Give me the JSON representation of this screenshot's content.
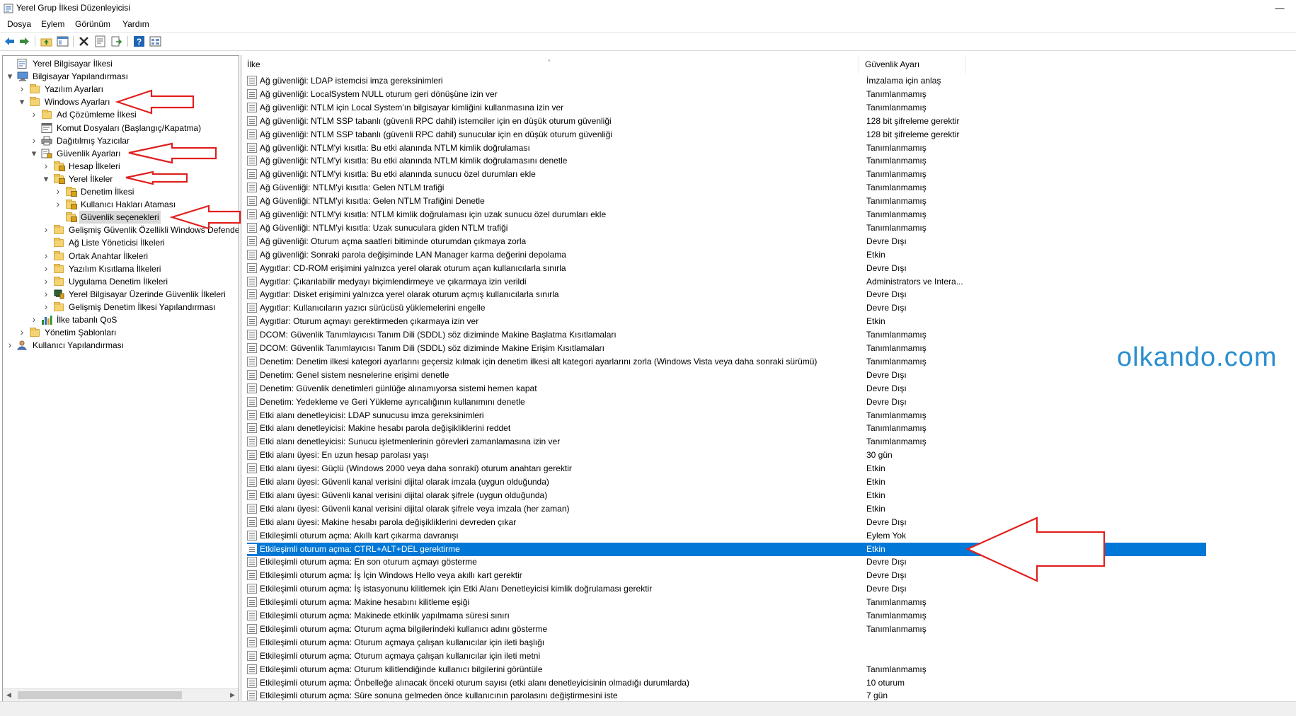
{
  "window": {
    "title": "Yerel Grup İlkesi Düzenleyicisi",
    "minimize": "—"
  },
  "menu": [
    "Dosya",
    "Eylem",
    "Görünüm",
    "Yardım"
  ],
  "toolbar": {
    "buttons": [
      "back-arrow-icon",
      "forward-arrow-icon",
      "up-folder-icon",
      "show-hide-tree-icon",
      "delete-icon",
      "properties-icon",
      "export-list-icon",
      "help-icon",
      "view-icon"
    ],
    "colors": {
      "back": "#1e78c8",
      "forward": "#3c8c3c",
      "delete": "#303030",
      "help": "#1e64b4"
    }
  },
  "tree": [
    {
      "level": 0,
      "label": "Yerel Bilgisayar İlkesi",
      "expander": "",
      "icon": "computer-policy-icon"
    },
    {
      "level": 0,
      "label": "Bilgisayar Yapılandırması",
      "expander": "open",
      "icon": "computer-icon"
    },
    {
      "level": 1,
      "label": "Yazılım Ayarları",
      "expander": "closed",
      "icon": "folder-icon"
    },
    {
      "level": 1,
      "label": "Windows Ayarları",
      "expander": "open",
      "icon": "folder-icon"
    },
    {
      "level": 2,
      "label": "Ad Çözümleme İlkesi",
      "expander": "closed",
      "icon": "folder-icon"
    },
    {
      "level": 2,
      "label": "Komut Dosyaları (Başlangıç/Kapatma)",
      "expander": "",
      "icon": "script-icon"
    },
    {
      "level": 2,
      "label": "Dağıtılmış Yazıcılar",
      "expander": "closed",
      "icon": "printer-icon"
    },
    {
      "level": 2,
      "label": "Güvenlik Ayarları",
      "expander": "open",
      "icon": "security-settings-icon"
    },
    {
      "level": 3,
      "label": "Hesap İlkeleri",
      "expander": "closed",
      "icon": "secure-folder-icon"
    },
    {
      "level": 3,
      "label": "Yerel İlkeler",
      "expander": "open",
      "icon": "secure-folder-icon"
    },
    {
      "level": 4,
      "label": "Denetim İlkesi",
      "expander": "closed",
      "icon": "secure-folder-icon"
    },
    {
      "level": 4,
      "label": "Kullanıcı Hakları Ataması",
      "expander": "closed",
      "icon": "secure-folder-icon"
    },
    {
      "level": 4,
      "label": "Güvenlik seçenekleri",
      "expander": "",
      "icon": "secure-folder-icon",
      "selected": true
    },
    {
      "level": 3,
      "label": "Gelişmiş Güvenlik Özellikli Windows Defender",
      "expander": "closed",
      "icon": "folder-icon"
    },
    {
      "level": 3,
      "label": "Ağ Liste Yöneticisi İlkeleri",
      "expander": "",
      "icon": "folder-icon"
    },
    {
      "level": 3,
      "label": "Ortak Anahtar İlkeleri",
      "expander": "closed",
      "icon": "folder-icon"
    },
    {
      "level": 3,
      "label": "Yazılım Kısıtlama İlkeleri",
      "expander": "closed",
      "icon": "folder-icon"
    },
    {
      "level": 3,
      "label": "Uygulama Denetim İlkeleri",
      "expander": "closed",
      "icon": "folder-icon"
    },
    {
      "level": 3,
      "label": "Yerel Bilgisayar Üzerinde Güvenlik İlkeleri",
      "expander": "closed",
      "icon": "ip-security-icon"
    },
    {
      "level": 3,
      "label": "Gelişmiş Denetim İlkesi Yapılandırması",
      "expander": "closed",
      "icon": "folder-icon"
    },
    {
      "level": 2,
      "label": "İlke tabanlı QoS",
      "expander": "closed",
      "icon": "qos-chart-icon"
    },
    {
      "level": 1,
      "label": "Yönetim Şablonları",
      "expander": "closed",
      "icon": "folder-icon"
    },
    {
      "level": 0,
      "label": "Kullanıcı Yapılandırması",
      "expander": "closed",
      "icon": "user-icon"
    }
  ],
  "list": {
    "columns": [
      "İlke",
      "Güvenlik Ayarı"
    ],
    "selected_index": 35,
    "rows": [
      [
        "Ağ güvenliği: LDAP istemcisi imza gereksinimleri",
        "İmzalama için anlaş"
      ],
      [
        "Ağ güvenliği: LocalSystem NULL oturum geri dönüşüne izin ver",
        "Tanımlanmamış"
      ],
      [
        "Ağ güvenliği: NTLM için Local System'ın bilgisayar kimliğini kullanmasına izin ver",
        "Tanımlanmamış"
      ],
      [
        "Ağ güvenliği: NTLM SSP tabanlı (güvenli RPC dahil) istemciler için en düşük oturum güvenliği",
        "128 bit şifreleme gerektir"
      ],
      [
        "Ağ güvenliği: NTLM SSP tabanlı (güvenli RPC dahil) sunucular için en düşük oturum güvenliği",
        "128 bit şifreleme gerektir"
      ],
      [
        "Ağ güvenliği: NTLM'yi kısıtla: Bu etki alanında NTLM kimlik doğrulaması",
        "Tanımlanmamış"
      ],
      [
        "Ağ güvenliği: NTLM'yi kısıtla: Bu etki alanında NTLM kimlik doğrulamasını denetle",
        "Tanımlanmamış"
      ],
      [
        "Ağ güvenliği: NTLM'yi kısıtla: Bu etki alanında sunucu özel durumları ekle",
        "Tanımlanmamış"
      ],
      [
        "Ağ Güvenliği: NTLM'yi kısıtla: Gelen NTLM trafiği",
        "Tanımlanmamış"
      ],
      [
        "Ağ Güvenliği: NTLM'yi kısıtla: Gelen NTLM Trafiğini Denetle",
        "Tanımlanmamış"
      ],
      [
        "Ağ güvenliği: NTLM'yi kısıtla: NTLM kimlik doğrulaması için uzak sunucu özel durumları ekle",
        "Tanımlanmamış"
      ],
      [
        "Ağ Güvenliği: NTLM'yi kısıtla: Uzak sunuculara giden NTLM trafiği",
        "Tanımlanmamış"
      ],
      [
        "Ağ güvenliği: Oturum açma saatleri bitiminde oturumdan çıkmaya zorla",
        "Devre Dışı"
      ],
      [
        "Ağ güvenliği: Sonraki parola değişiminde LAN Manager karma değerini depolama",
        "Etkin"
      ],
      [
        "Aygıtlar: CD-ROM erişimini yalnızca yerel olarak oturum açan kullanıcılarla sınırla",
        "Devre Dışı"
      ],
      [
        "Aygıtlar: Çıkarılabilir medyayı biçimlendirmeye ve çıkarmaya izin verildi",
        "Administrators ve Intera..."
      ],
      [
        "Aygıtlar: Disket erişimini yalnızca yerel olarak oturum açmış kullanıcılarla sınırla",
        "Devre Dışı"
      ],
      [
        "Aygıtlar: Kullanıcıların yazıcı sürücüsü yüklemelerini engelle",
        "Devre Dışı"
      ],
      [
        "Aygıtlar: Oturum açmayı gerektirmeden çıkarmaya izin ver",
        "Etkin"
      ],
      [
        "DCOM: Güvenlik Tanımlayıcısı Tanım Dili (SDDL) söz diziminde Makine Başlatma Kısıtlamaları",
        "Tanımlanmamış"
      ],
      [
        "DCOM: Güvenlik Tanımlayıcısı Tanım Dili (SDDL) söz diziminde Makine Erişim Kısıtlamaları",
        "Tanımlanmamış"
      ],
      [
        "Denetim: Denetim ilkesi kategori ayarlarını geçersiz kılmak için denetim ilkesi alt kategori ayarlarını zorla (Windows Vista veya daha sonraki sürümü)",
        "Tanımlanmamış"
      ],
      [
        "Denetim: Genel sistem nesnelerine erişimi denetle",
        "Devre Dışı"
      ],
      [
        "Denetim: Güvenlik denetimleri günlüğe alınamıyorsa sistemi hemen kapat",
        "Devre Dışı"
      ],
      [
        "Denetim: Yedekleme ve Geri Yükleme ayrıcalığının kullanımını denetle",
        "Devre Dışı"
      ],
      [
        "Etki alanı denetleyicisi: LDAP sunucusu imza gereksinimleri",
        "Tanımlanmamış"
      ],
      [
        "Etki alanı denetleyicisi: Makine hesabı parola değişikliklerini reddet",
        "Tanımlanmamış"
      ],
      [
        "Etki alanı denetleyicisi: Sunucu işletmenlerinin görevleri zamanlamasına izin ver",
        "Tanımlanmamış"
      ],
      [
        "Etki alanı üyesi: En uzun hesap parolası yaşı",
        "30 gün"
      ],
      [
        "Etki alanı üyesi: Güçlü (Windows 2000 veya daha sonraki) oturum anahtarı gerektir",
        "Etkin"
      ],
      [
        "Etki alanı üyesi: Güvenli kanal verisini dijital olarak imzala (uygun olduğunda)",
        "Etkin"
      ],
      [
        "Etki alanı üyesi: Güvenli kanal verisini dijital olarak şifrele (uygun olduğunda)",
        "Etkin"
      ],
      [
        "Etki alanı üyesi: Güvenli kanal verisini dijital olarak şifrele veya imzala (her zaman)",
        "Etkin"
      ],
      [
        "Etki alanı üyesi: Makine hesabı parola değişikliklerini devreden çıkar",
        "Devre Dışı"
      ],
      [
        "Etkileşimli oturum açma: Akıllı kart çıkarma davranışı",
        "Eylem Yok"
      ],
      [
        "Etkileşimli oturum açma: CTRL+ALT+DEL gerektirme",
        "Etkin"
      ],
      [
        "Etkileşimli oturum açma: En son oturum açmayı gösterme",
        "Devre Dışı"
      ],
      [
        "Etkileşimli oturum açma: İş İçin Windows Hello veya akıllı kart gerektir",
        "Devre Dışı"
      ],
      [
        "Etkileşimli oturum açma: İş istasyonunu kilitlemek için Etki Alanı Denetleyicisi kimlik doğrulaması gerektir",
        "Devre Dışı"
      ],
      [
        "Etkileşimli oturum açma: Makine hesabını kilitleme eşiği",
        "Tanımlanmamış"
      ],
      [
        "Etkileşimli oturum açma: Makinede etkinlik yapılmama süresi sınırı",
        "Tanımlanmamış"
      ],
      [
        "Etkileşimli oturum açma: Oturum açma bilgilerindeki kullanıcı adını gösterme",
        "Tanımlanmamış"
      ],
      [
        "Etkileşimli oturum açma: Oturum açmaya çalışan kullanıcılar için ileti başlığı",
        ""
      ],
      [
        "Etkileşimli oturum açma: Oturum açmaya çalışan kullanıcılar için ileti metni",
        ""
      ],
      [
        "Etkileşimli oturum açma: Oturum kilitlendiğinde kullanıcı bilgilerini görüntüle",
        "Tanımlanmamış"
      ],
      [
        "Etkileşimli oturum açma: Önbelleğe alınacak önceki oturum sayısı (etki alanı denetleyicisinin olmadığı durumlarda)",
        "10 oturum"
      ],
      [
        "Etkileşimli oturum açma: Süre sonuna gelmeden önce kullanıcının parolasını değiştirmesini iste",
        "7 gün"
      ]
    ]
  },
  "watermark": "olkando.com",
  "annotation_color": "#e0201e",
  "highlight_color": "#0078d7"
}
